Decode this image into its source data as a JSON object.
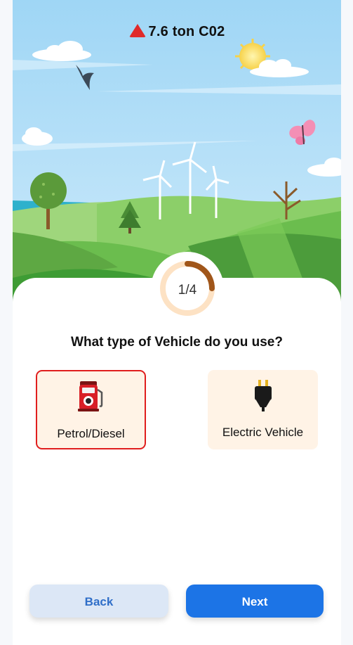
{
  "header": {
    "emission_value": "7.6 ton C02",
    "warning_icon": "warning-triangle-icon",
    "warning_color": "#e02a2a"
  },
  "progress": {
    "label": "1/4",
    "fraction": 0.25,
    "track_color": "#fde2c4",
    "fill_color": "#a0561a"
  },
  "question": {
    "text": "What type of Vehicle do you use?"
  },
  "options": [
    {
      "label": "Petrol/Diesel",
      "icon": "fuel-pump-icon",
      "selected": true
    },
    {
      "label": "Electric Vehicle",
      "icon": "electric-plug-icon",
      "selected": false
    }
  ],
  "buttons": {
    "back_label": "Back",
    "next_label": "Next"
  },
  "colors": {
    "primary": "#1c74e6",
    "selected_border": "#e01e1e",
    "option_bg": "#fff3e6"
  }
}
